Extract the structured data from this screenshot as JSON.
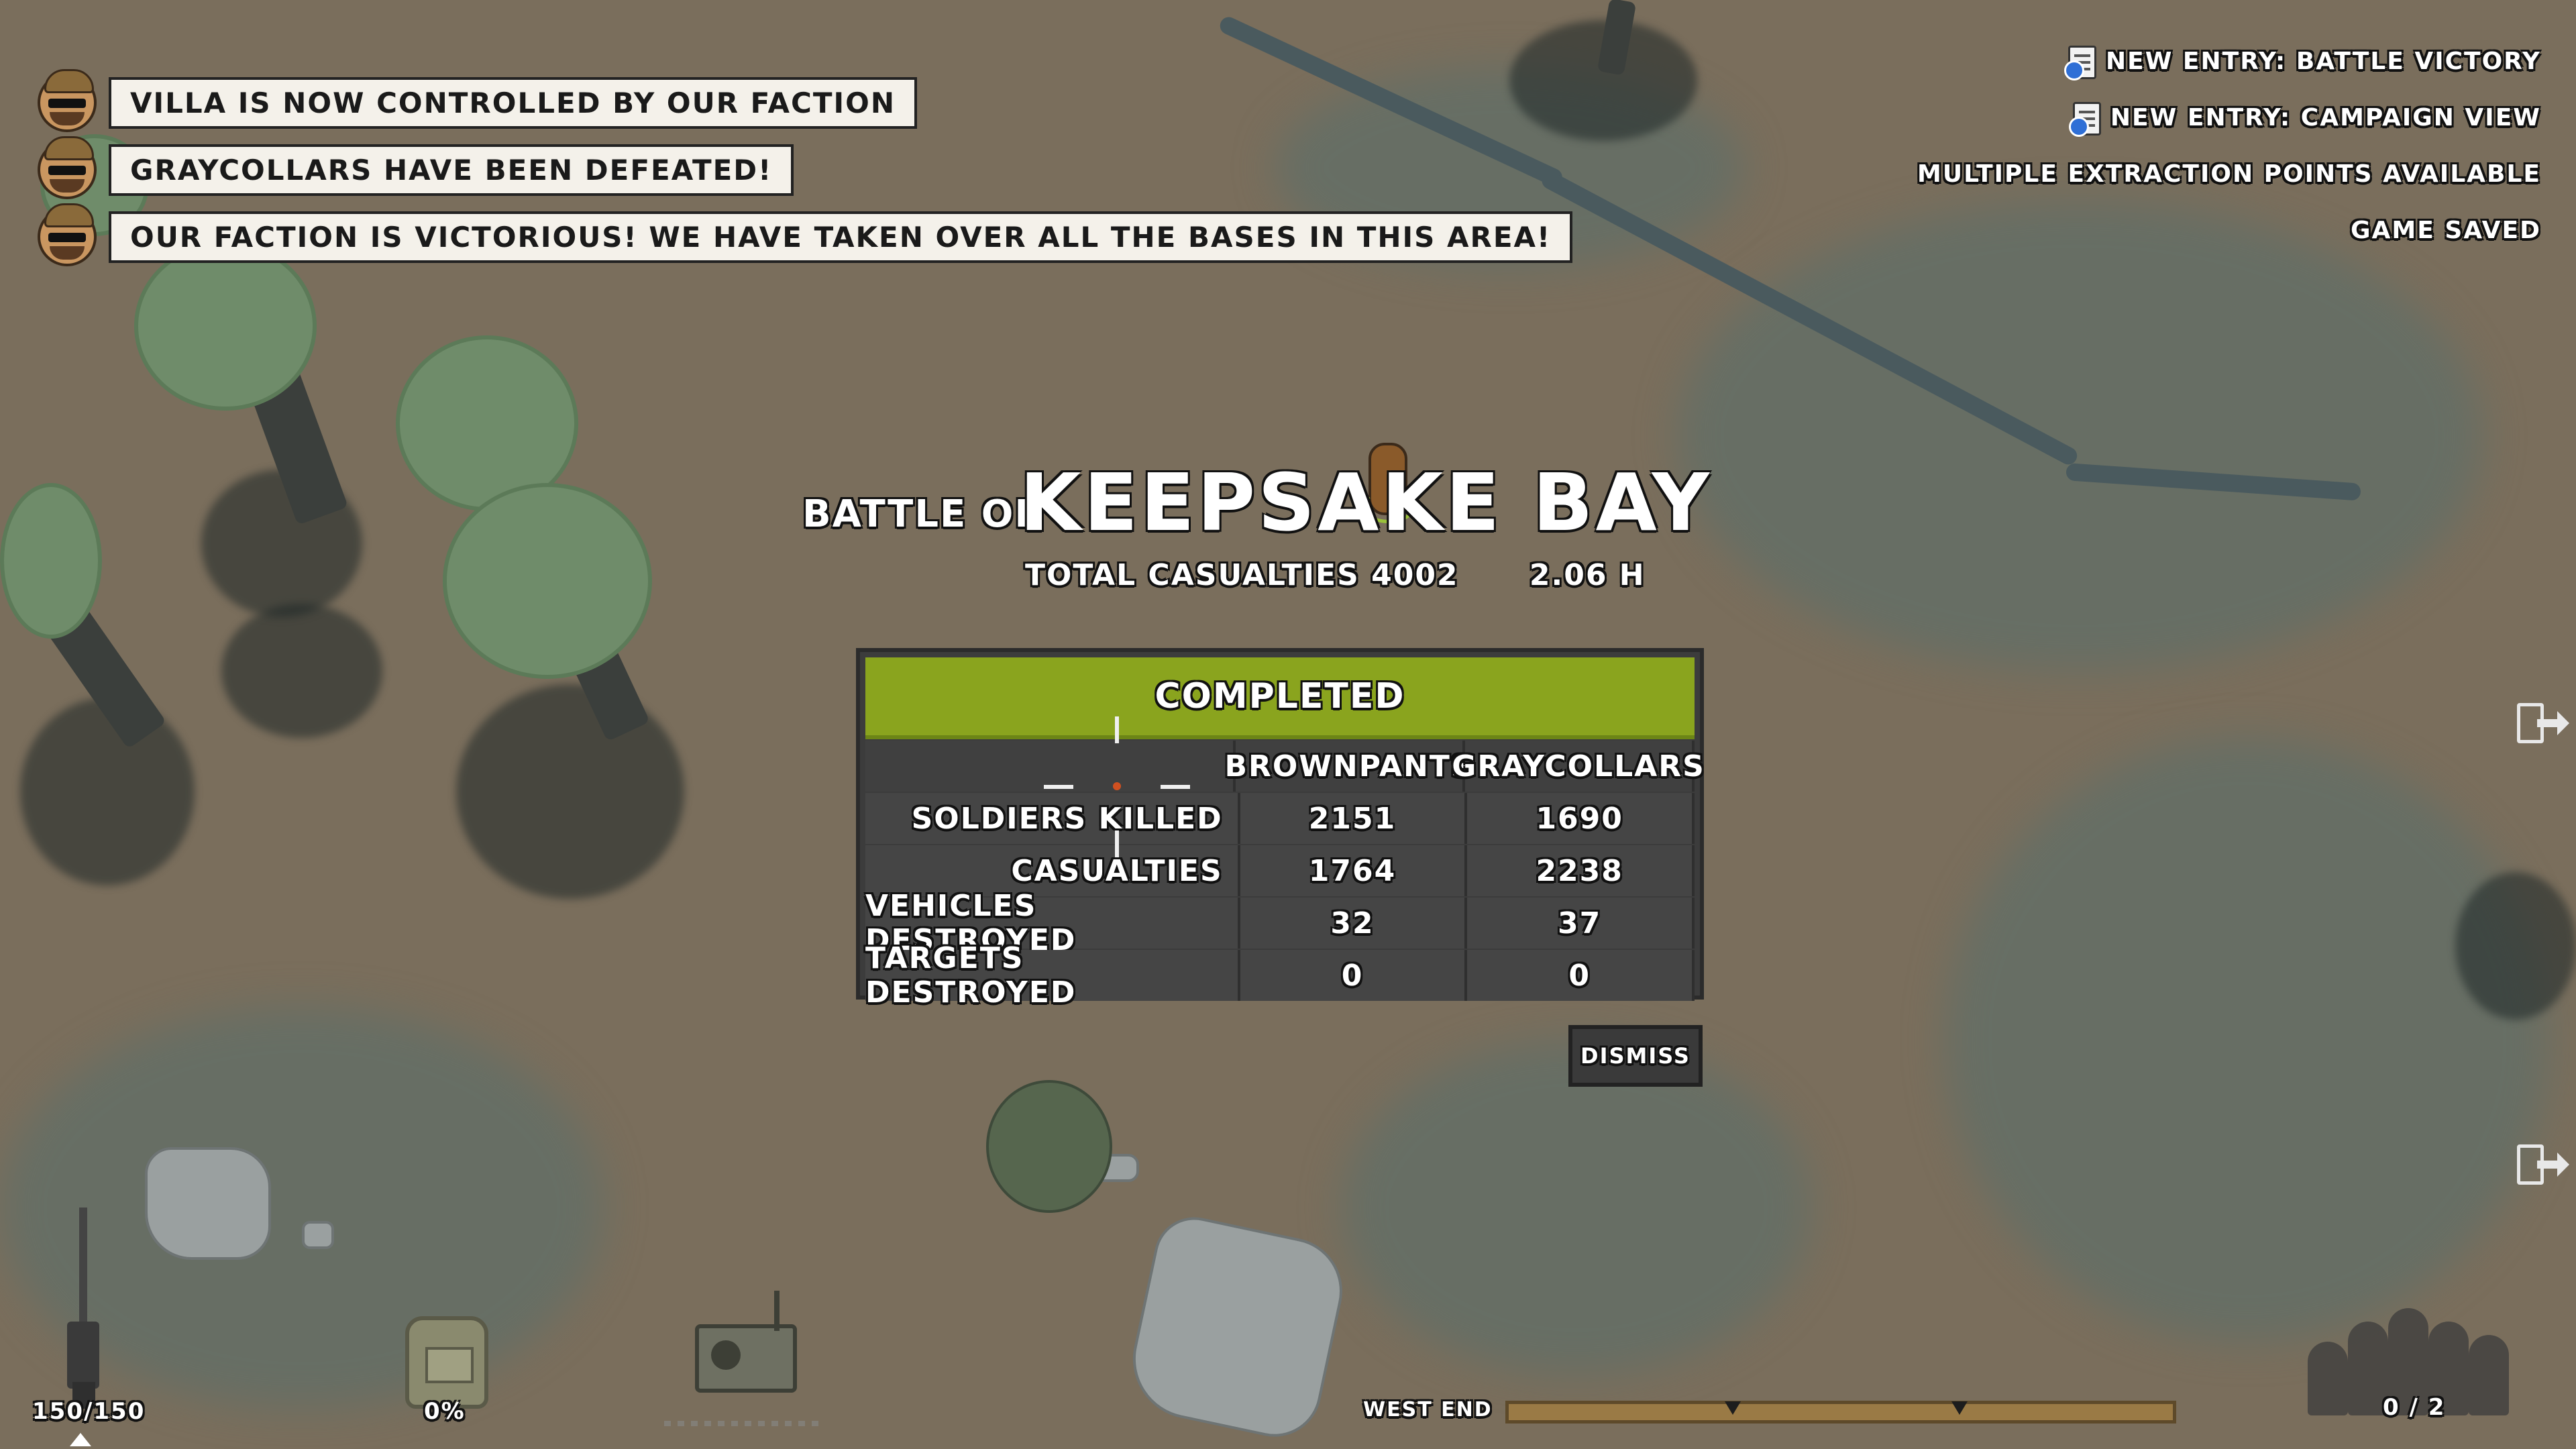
{
  "notifications": [
    {
      "text": "Villa is now controlled by our faction"
    },
    {
      "text": "Graycollars have been defeated!"
    },
    {
      "text": "Our faction is victorious! We have taken over all the bases in this area!"
    }
  ],
  "log": [
    {
      "text": "New entry: Battle victory",
      "icon": "journal-icon"
    },
    {
      "text": "New entry: Campaign view",
      "icon": "journal-icon"
    },
    {
      "text": "Multiple extraction points available"
    },
    {
      "text": "Game saved"
    }
  ],
  "battle": {
    "prefix": "Battle of",
    "name": "Keepsake Bay",
    "casualties_label": "Total casualties 4002",
    "duration_label": "2.06 h"
  },
  "results": {
    "status": "Completed",
    "columns": [
      "Brownpants",
      "Graycollars"
    ],
    "rows": [
      {
        "label": "Soldiers killed",
        "values": [
          "2151",
          "1690"
        ]
      },
      {
        "label": "Casualties",
        "values": [
          "1764",
          "2238"
        ]
      },
      {
        "label": "Vehicles destroyed",
        "values": [
          "32",
          "37"
        ]
      },
      {
        "label": "Targets destroyed",
        "values": [
          "0",
          "0"
        ]
      }
    ],
    "status_color": "#8aa41e"
  },
  "dismiss_label": "Dismiss",
  "hud": {
    "ammo": "150/150",
    "backpack_percent": "0%",
    "location": "West End",
    "squad": "0 / 2"
  }
}
